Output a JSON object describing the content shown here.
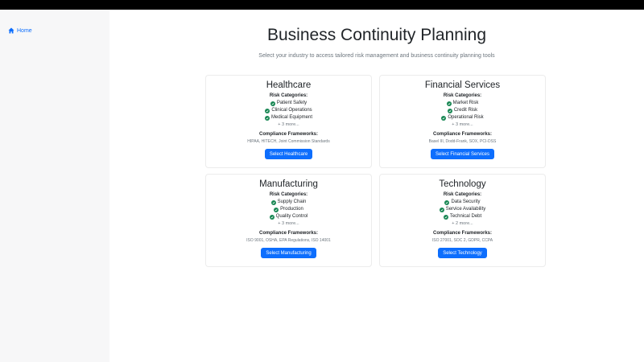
{
  "nav": {
    "home_label": "Home"
  },
  "page": {
    "title": "Business Continuity Planning",
    "subtitle": "Select your industry to access tailored risk management and business continuity planning tools"
  },
  "labels": {
    "risk_categories": "Risk Categories:",
    "compliance_frameworks": "Compliance Frameworks:"
  },
  "industries": [
    {
      "name": "Healthcare",
      "risks": [
        "Patient Safety",
        "Clinical Operations",
        "Medical Equipment"
      ],
      "more": "+ 3 more...",
      "frameworks": "HIPAA, HITECH, Joint Commission Standards",
      "button": "Select Healthcare"
    },
    {
      "name": "Financial Services",
      "risks": [
        "Market Risk",
        "Credit Risk",
        "Operational Risk"
      ],
      "more": "+ 3 more...",
      "frameworks": "Basel III, Dodd-Frank, SOX, PCI-DSS",
      "button": "Select Financial Services"
    },
    {
      "name": "Manufacturing",
      "risks": [
        "Supply Chain",
        "Production",
        "Quality Control"
      ],
      "more": "+ 3 more...",
      "frameworks": "ISO 9001, OSHA, EPA Regulations, ISO 14001",
      "button": "Select Manufacturing"
    },
    {
      "name": "Technology",
      "risks": [
        "Data Security",
        "Service Availability",
        "Technical Debt"
      ],
      "more": "+ 2 more...",
      "frameworks": "ISO 27001, SOC 2, GDPR, CCPA",
      "button": "Select Technology"
    }
  ],
  "colors": {
    "primary": "#0d6efd",
    "success": "#198754",
    "muted": "#6c757d",
    "sidebar": "#f7f7f8"
  },
  "icons": {
    "home": "home-icon",
    "check": "check-circle-icon"
  }
}
